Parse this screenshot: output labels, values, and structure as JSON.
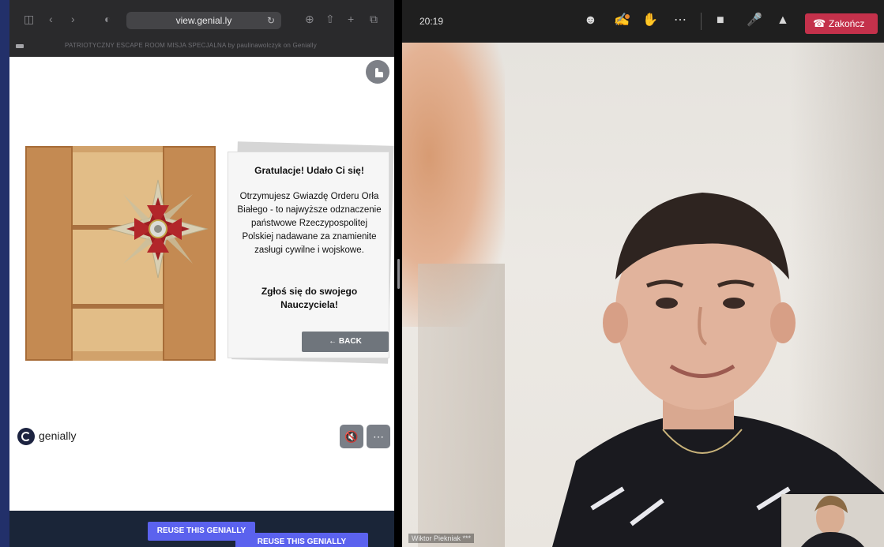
{
  "safari": {
    "url": "view.genial.ly",
    "strip_text": "PATRIOTYCZNY ESCAPE ROOM MISJA SPECJALNA by paulinawolczyk on Genially"
  },
  "genially": {
    "panel_title": "Gratulacje! Udało Ci się!",
    "panel_body": "Otrzymujesz Gwiazdę Orderu Orła Białego - to najwyższe odznaczenie państwowe Rzeczypospolitej Polskiej nadawane za znamienite zasługi cywilne i wojskowe.",
    "panel_cta": "Zgłoś się do swojego Nauczyciela!",
    "back_label": "← BACK",
    "logo_text": "genially",
    "reuse_label_1": "REUSE THIS GENIALLY",
    "reuse_label_2": "REUSE THIS GENIALLY"
  },
  "teams": {
    "timer": "20:19",
    "end_call_label": "Zakończ",
    "participant_name": "Wiktor Piekniak ***"
  },
  "colors": {
    "end_call": "#c4314b",
    "reuse_button": "#5b62ee",
    "back_button": "#6f757c"
  }
}
